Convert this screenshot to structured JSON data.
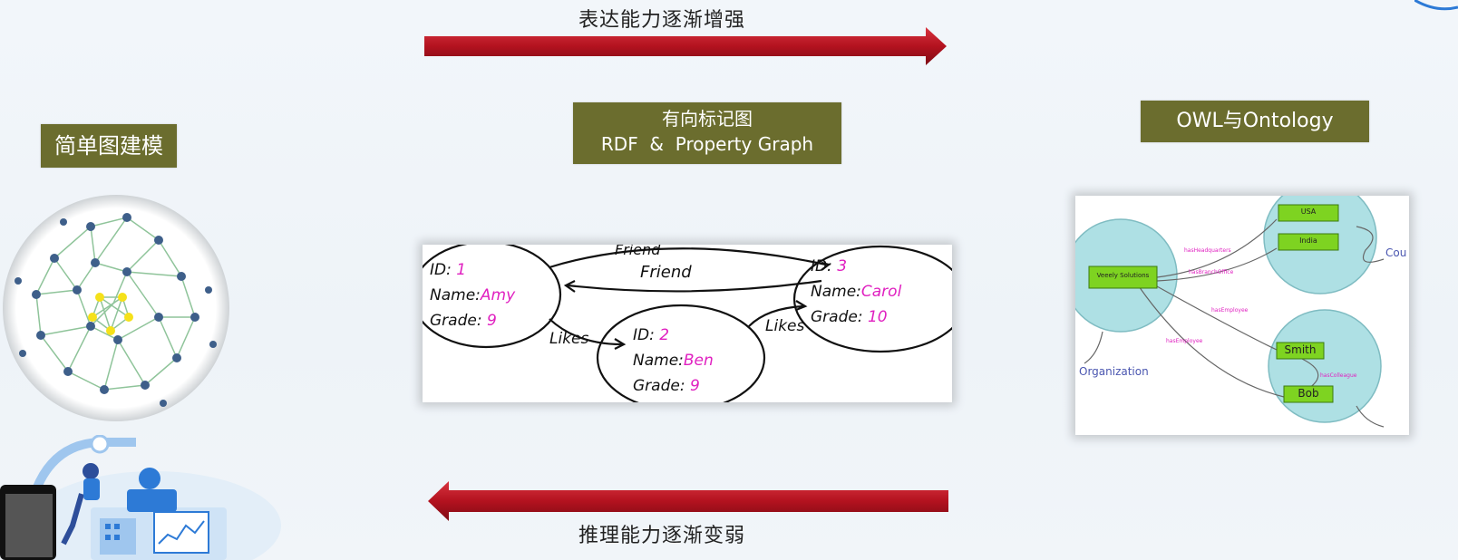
{
  "top_arrow": {
    "label": "表达能力逐渐增强",
    "color": "#b3121f"
  },
  "bottom_arrow": {
    "label": "推理能力逐渐变弱",
    "color": "#b3121f"
  },
  "col1": {
    "title": "简单图建模"
  },
  "col2": {
    "title_line1": "有向标记图",
    "title_line2": "RDF  &  Property Graph",
    "nodes": [
      {
        "id": "1",
        "name": "Amy",
        "grade": "9"
      },
      {
        "id": "2",
        "name": "Ben",
        "grade": "9"
      },
      {
        "id": "3",
        "name": "Carol",
        "grade": "10"
      }
    ],
    "field_labels": {
      "id": "ID:",
      "name": "Name:",
      "grade": "Grade:"
    },
    "edge_labels": {
      "friend_top": "Friend",
      "friend_mid": "Friend",
      "likes_left": "Likes",
      "likes_right": "Likes"
    }
  },
  "col3": {
    "title": "OWL与Ontology",
    "boxes": {
      "company": "Veeely Solutions",
      "usa": "USA",
      "india": "India",
      "smith": "Smith",
      "bob": "Bob"
    },
    "labels": {
      "organization": "Organization",
      "country": "Cou"
    }
  },
  "colors": {
    "olive": "#6b6d2e",
    "teal": "#aee0e4",
    "green_box": "#7ed321",
    "pink": "#e020c0"
  }
}
